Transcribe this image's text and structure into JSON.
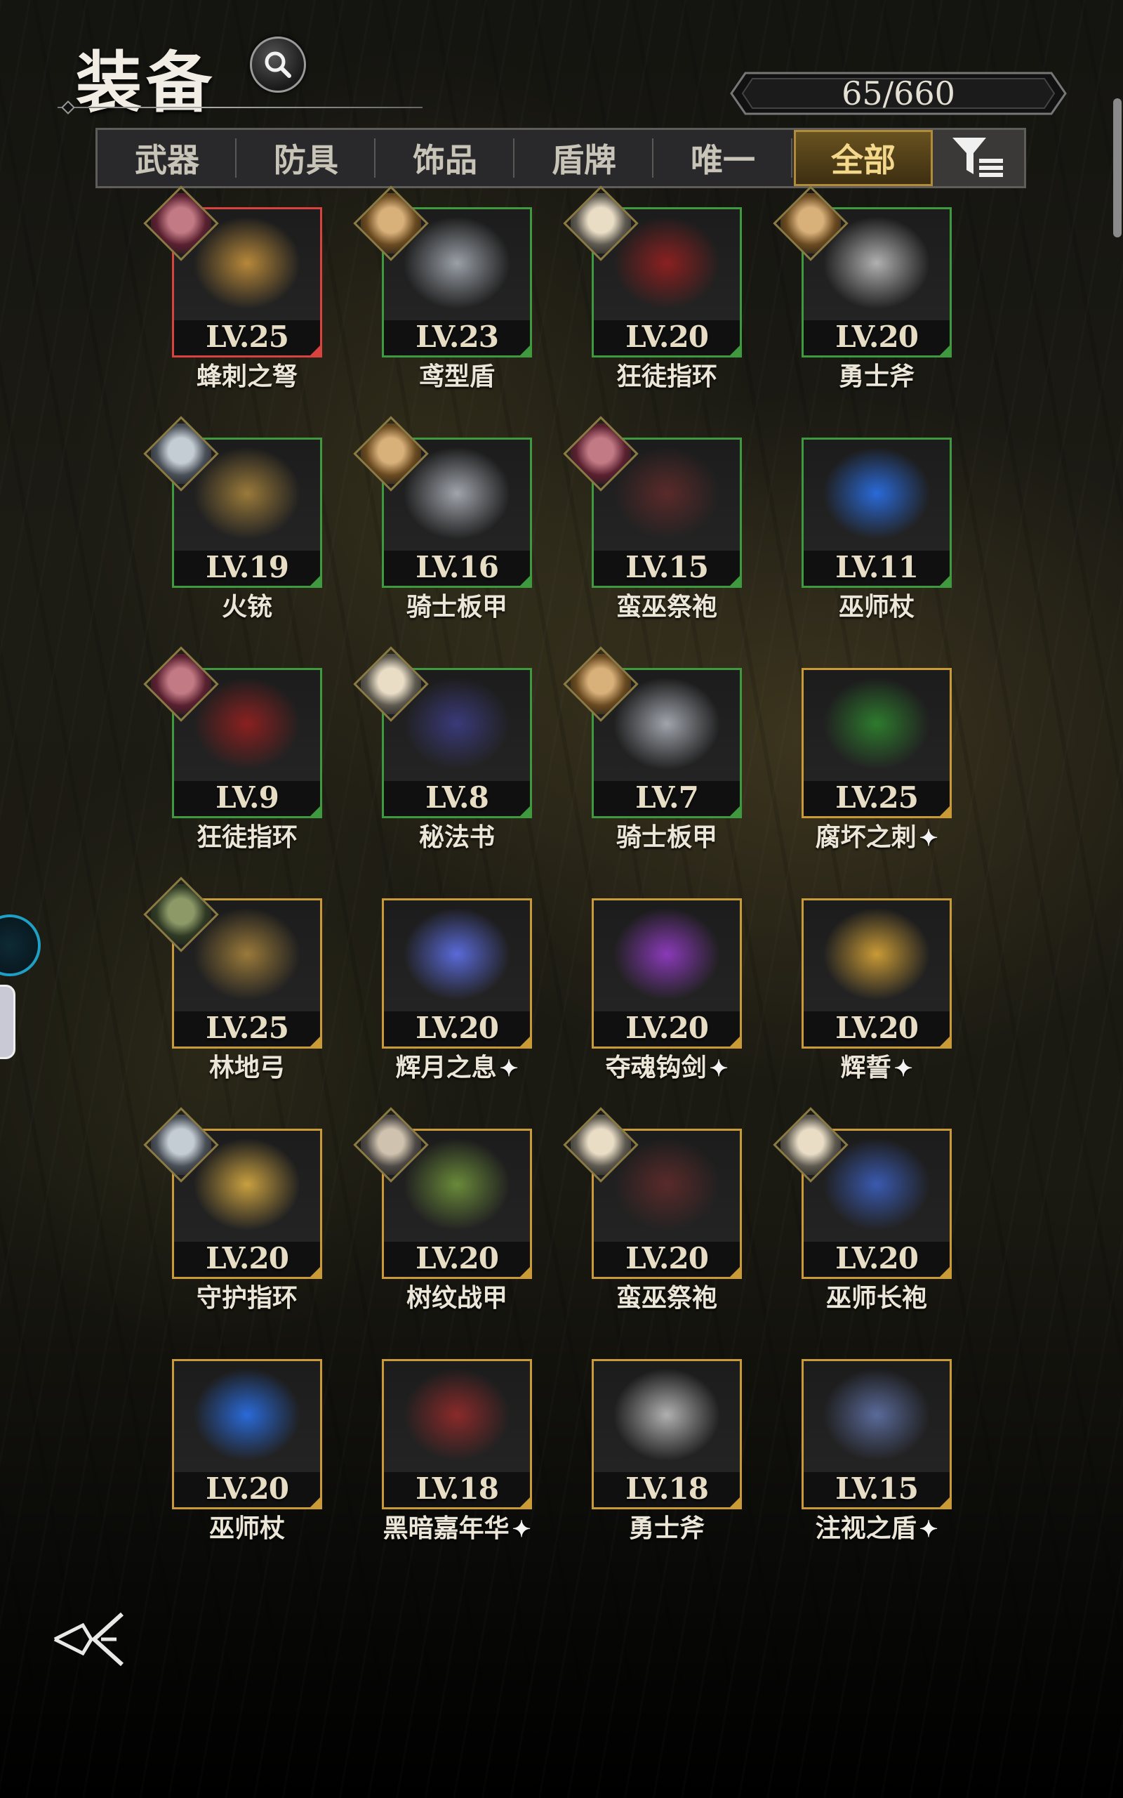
{
  "header": {
    "title": "装备",
    "count": "65/660"
  },
  "tabs": [
    {
      "label": "武器"
    },
    {
      "label": "防具"
    },
    {
      "label": "饰品"
    },
    {
      "label": "盾牌"
    },
    {
      "label": "唯一"
    },
    {
      "label": "全部",
      "active": true
    }
  ],
  "icons": {
    "search": "search-icon",
    "filter": "filter-icon",
    "back": "back-icon"
  },
  "colors": {
    "green": "#3f9a3f",
    "red": "#d8433f",
    "gold": "#c99a36",
    "active_tab": "#b28b3a"
  },
  "items": [
    {
      "lv": "LV.25",
      "name": "蜂刺之弩",
      "rarity": "red",
      "portrait": "pink"
    },
    {
      "lv": "LV.23",
      "name": "鸢型盾",
      "rarity": "green",
      "portrait": "blonde"
    },
    {
      "lv": "LV.20",
      "name": "狂徒指环",
      "rarity": "green",
      "portrait": "white"
    },
    {
      "lv": "LV.20",
      "name": "勇士斧",
      "rarity": "green",
      "portrait": "blonde"
    },
    {
      "lv": "LV.19",
      "name": "火铳",
      "rarity": "green",
      "portrait": "silver"
    },
    {
      "lv": "LV.16",
      "name": "骑士板甲",
      "rarity": "green",
      "portrait": "blonde"
    },
    {
      "lv": "LV.15",
      "name": "蛮巫祭袍",
      "rarity": "green",
      "portrait": "pink"
    },
    {
      "lv": "LV.11",
      "name": "巫师杖",
      "rarity": "green",
      "portrait": ""
    },
    {
      "lv": "LV.9",
      "name": "狂徒指环",
      "rarity": "green",
      "portrait": "pink"
    },
    {
      "lv": "LV.8",
      "name": "秘法书",
      "rarity": "green",
      "portrait": "white"
    },
    {
      "lv": "LV.7",
      "name": "骑士板甲",
      "rarity": "green",
      "portrait": "blonde"
    },
    {
      "lv": "LV.25",
      "name": "腐坏之刺",
      "rarity": "gold",
      "portrait": "",
      "star": true
    },
    {
      "lv": "LV.25",
      "name": "林地弓",
      "rarity": "gold",
      "portrait": "green"
    },
    {
      "lv": "LV.20",
      "name": "辉月之息",
      "rarity": "gold",
      "portrait": "",
      "star": true
    },
    {
      "lv": "LV.20",
      "name": "夺魂钩剑",
      "rarity": "gold",
      "portrait": "",
      "star": true
    },
    {
      "lv": "LV.20",
      "name": "辉誓",
      "rarity": "gold",
      "portrait": "",
      "star": true
    },
    {
      "lv": "LV.20",
      "name": "守护指环",
      "rarity": "gold",
      "portrait": "silver"
    },
    {
      "lv": "LV.20",
      "name": "树纹战甲",
      "rarity": "gold",
      "portrait": "grey"
    },
    {
      "lv": "LV.20",
      "name": "蛮巫祭袍",
      "rarity": "gold",
      "portrait": "white"
    },
    {
      "lv": "LV.20",
      "name": "巫师长袍",
      "rarity": "gold",
      "portrait": "white"
    },
    {
      "lv": "LV.20",
      "name": "巫师杖",
      "rarity": "gold",
      "portrait": ""
    },
    {
      "lv": "LV.18",
      "name": "黑暗嘉年华",
      "rarity": "gold",
      "portrait": "",
      "star": true
    },
    {
      "lv": "LV.18",
      "name": "勇士斧",
      "rarity": "gold",
      "portrait": ""
    },
    {
      "lv": "LV.15",
      "name": "注视之盾",
      "rarity": "gold",
      "portrait": "",
      "star": true
    }
  ]
}
